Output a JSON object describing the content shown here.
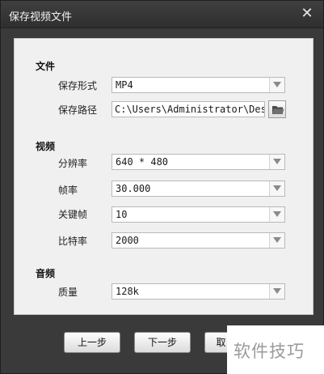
{
  "window": {
    "title": "保存视频文件",
    "close_symbol": "✕"
  },
  "file_section": {
    "heading": "文件",
    "format_label": "保存形式",
    "format_value": "MP4",
    "path_label": "保存路径",
    "path_value": "C:\\Users\\Administrator\\Desktop"
  },
  "video_section": {
    "heading": "视频",
    "resolution_label": "分辨率",
    "resolution_value": "640 * 480",
    "framerate_label": "帧率",
    "framerate_value": "30.000",
    "keyframe_label": "关键帧",
    "keyframe_value": "10",
    "bitrate_label": "比特率",
    "bitrate_value": "2000"
  },
  "audio_section": {
    "heading": "音频",
    "quality_label": "质量",
    "quality_value": "128k"
  },
  "buttons": {
    "prev": "上一步",
    "next": "下一步",
    "cancel_partial": "取"
  },
  "watermark": {
    "text": "软件技巧"
  }
}
